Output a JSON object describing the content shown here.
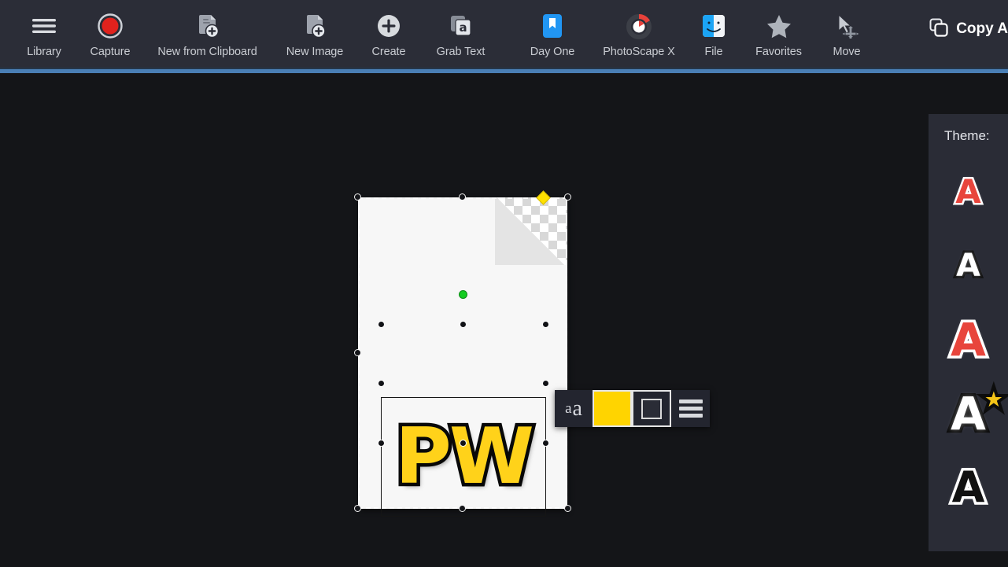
{
  "app": {
    "background_color": "#141518",
    "toolbar_color": "#2b2d37",
    "accent_color": "#4a7fb5",
    "panel_color": "#2a2c36"
  },
  "toolbar": {
    "items": [
      {
        "label": "Library",
        "icon": "hamburger-menu-icon"
      },
      {
        "label": "Capture",
        "icon": "record-circle-icon"
      },
      {
        "label": "New from Clipboard",
        "icon": "document-plus-icon"
      },
      {
        "label": "New Image",
        "icon": "image-plus-icon"
      },
      {
        "label": "Create",
        "icon": "plus-circle-icon"
      },
      {
        "label": "Grab Text",
        "icon": "grab-text-icon"
      },
      {
        "label": "Day One",
        "icon": "day-one-bookmark-icon"
      },
      {
        "label": "PhotoScape X",
        "icon": "photoscape-x-icon"
      },
      {
        "label": "File",
        "icon": "finder-icon"
      },
      {
        "label": "Favorites",
        "icon": "star-icon"
      },
      {
        "label": "Move",
        "icon": "move-cursor-icon"
      }
    ],
    "copy_all": {
      "label": "Copy A",
      "icon": "copy-icon"
    }
  },
  "canvas": {
    "page": {
      "name": "document-page",
      "background": "#f7f7f7",
      "transparent_corner": true
    },
    "text_object": {
      "value": "PW",
      "fill_color": "#ffd21a",
      "stroke_color": "#0a0a0a",
      "selected": true
    },
    "handles": {
      "rotate_handle_color": "#ffe000",
      "anchor_dot_color": "#15cc22"
    }
  },
  "text_popup": {
    "size_label_small": "a",
    "size_label_large": "a",
    "fill_swatch_color": "#ffd400",
    "stroke_swatch_color": "#2a2c36",
    "align_icon": "align-lines-icon"
  },
  "sidebar": {
    "title": "Theme:",
    "themes": [
      {
        "name": "theme-red-outline",
        "glyph": "A",
        "color": "#e8453c",
        "stroke": "#ffffff",
        "size": 42,
        "starred": false
      },
      {
        "name": "theme-white-black",
        "glyph": "A",
        "color": "#ffffff",
        "stroke": "#111111",
        "size": 40,
        "starred": false
      },
      {
        "name": "theme-red-white-large",
        "glyph": "A",
        "color": "#e8453c",
        "stroke": "#ffffff",
        "size": 58,
        "starred": false
      },
      {
        "name": "theme-white-outline",
        "glyph": "A",
        "color": "#ffffff",
        "stroke": "#0d0d0d",
        "size": 58,
        "starred": true
      },
      {
        "name": "theme-black-on-white",
        "glyph": "A",
        "color": "#111111",
        "stroke": "#ffffff",
        "size": 54,
        "starred": false
      }
    ],
    "star_glyph": "★"
  }
}
